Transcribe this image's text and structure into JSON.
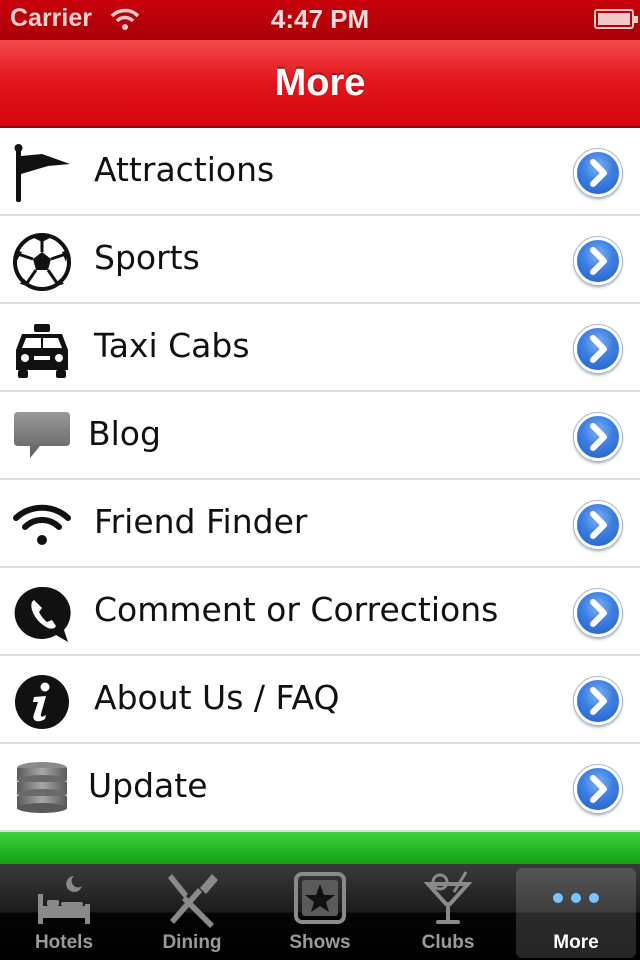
{
  "status_bar": {
    "carrier": "Carrier",
    "time": "4:47 PM"
  },
  "nav": {
    "title": "More"
  },
  "menu": [
    {
      "label": "Attractions",
      "icon": "flag-icon"
    },
    {
      "label": "Sports",
      "icon": "soccer-ball-icon"
    },
    {
      "label": "Taxi Cabs",
      "icon": "taxi-icon"
    },
    {
      "label": "Blog",
      "icon": "speech-bubble-icon"
    },
    {
      "label": "Friend Finder",
      "icon": "wifi-icon"
    },
    {
      "label": "Comment or Corrections",
      "icon": "phone-bubble-icon"
    },
    {
      "label": "About Us / FAQ",
      "icon": "info-icon"
    },
    {
      "label": "Update",
      "icon": "database-icon"
    }
  ],
  "tabs": [
    {
      "label": "Hotels",
      "icon": "bed-icon"
    },
    {
      "label": "Dining",
      "icon": "fork-knife-icon"
    },
    {
      "label": "Shows",
      "icon": "star-icon"
    },
    {
      "label": "Clubs",
      "icon": "cocktail-icon"
    },
    {
      "label": "More",
      "icon": "more-dots-icon",
      "active": true
    }
  ],
  "colors": {
    "nav_red": "#e3141a",
    "chevron_blue": "#3d7fe0",
    "ad_green": "#1fb51f"
  }
}
